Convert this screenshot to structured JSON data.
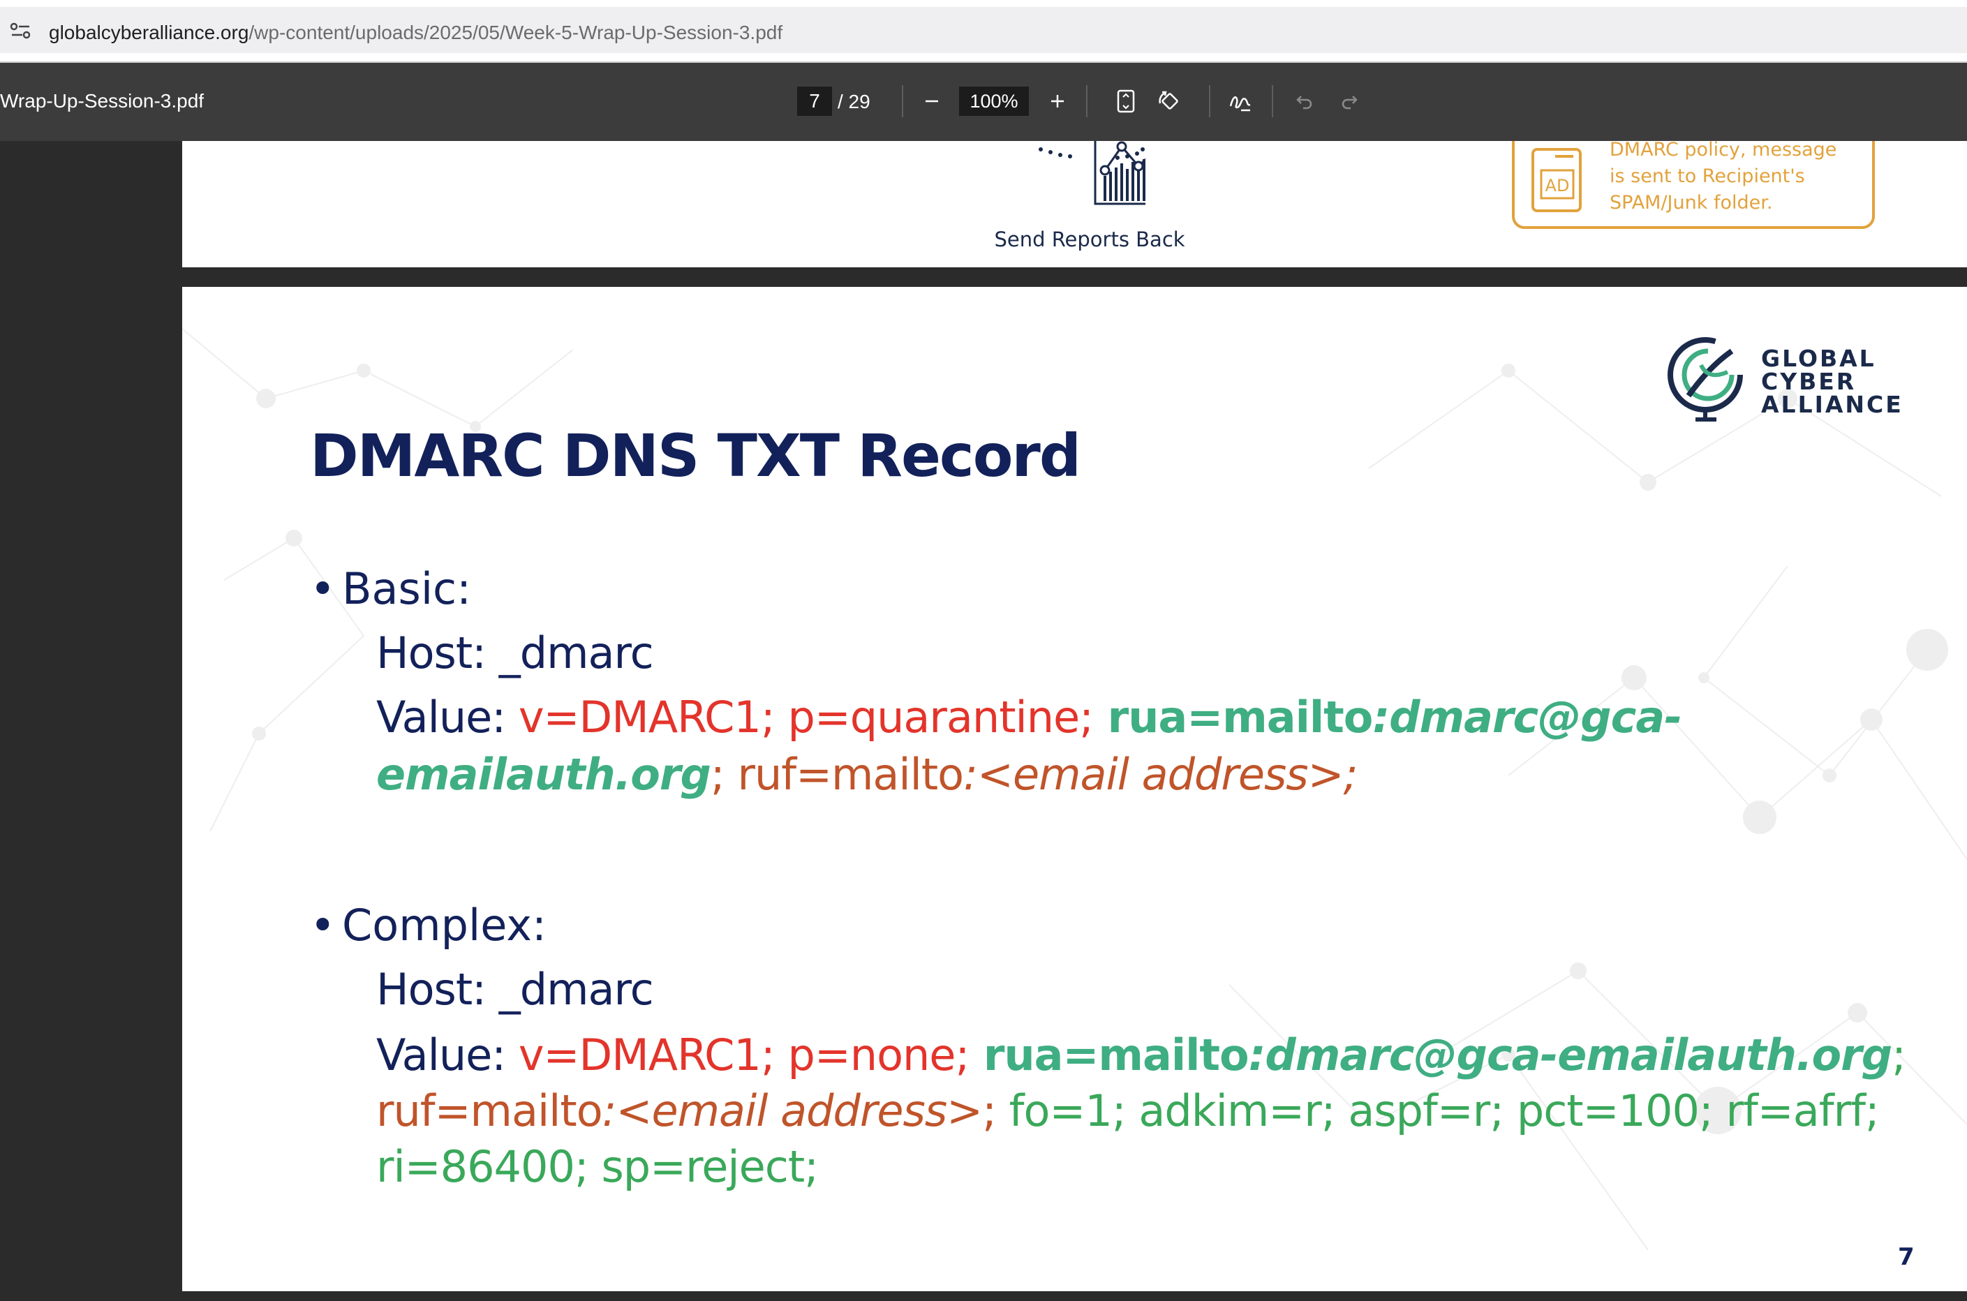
{
  "browser": {
    "url_host": "globalcyberalliance.org",
    "url_path": "/wp-content/uploads/2025/05/Week-5-Wrap-Up-Session-3.pdf"
  },
  "pdf_toolbar": {
    "doc_name": "Wrap-Up-Session-3.pdf",
    "page_current": "7",
    "page_total": "/ 29",
    "zoom": "100%",
    "icons": [
      "minus-icon",
      "plus-icon",
      "fit-page-icon",
      "rotate-icon",
      "annotate-icon",
      "undo-icon",
      "redo-icon"
    ]
  },
  "prev_page": {
    "caption": "Send Reports Back",
    "callout_lines": [
      "DMARC policy, message",
      "is sent to Recipient's",
      "SPAM/Junk folder."
    ],
    "callout_icon_label": "AD"
  },
  "slide": {
    "logo": {
      "line1": "GLOBAL",
      "line2": "CYBER",
      "line3": "ALLIANCE"
    },
    "title": "DMARC DNS TXT Record",
    "basic": {
      "heading": "Basic:",
      "host": "Host: _dmarc",
      "value_label": "Value: ",
      "v": "v=DMARC1;",
      "p": " p=quarantine;",
      "rua_key": " rua=mailto",
      "rua_val_1": ":dmarc@gca-",
      "rua_val_2": "emailauth.org",
      "sep": ";",
      "ruf_key": " ruf=mailto",
      "ruf_val": ":<email address>;"
    },
    "complex": {
      "heading": "Complex:",
      "host": "Host: _dmarc",
      "value_label": "Value: ",
      "v": "v=DMARC1;",
      "p": " p=none;",
      "rua_key": " rua=mailto",
      "rua_val": ":dmarc@gca-emailauth.org",
      "sep": ";",
      "ruf_key": "ruf=mailto",
      "ruf_val": ":<email address>",
      "ruf_sep": ";",
      "rest_1": " fo=1; adkim=r; aspf=r; pct=100; rf=afrf;",
      "rest_2": "ri=86400; sp=reject;"
    },
    "page_number": "7"
  },
  "colors": {
    "title_navy": "#13215a",
    "red": "#e3342b",
    "teal": "#3fae83",
    "rust": "#c0542a",
    "green": "#3aa85a",
    "callout_orange": "#e2a23c"
  }
}
